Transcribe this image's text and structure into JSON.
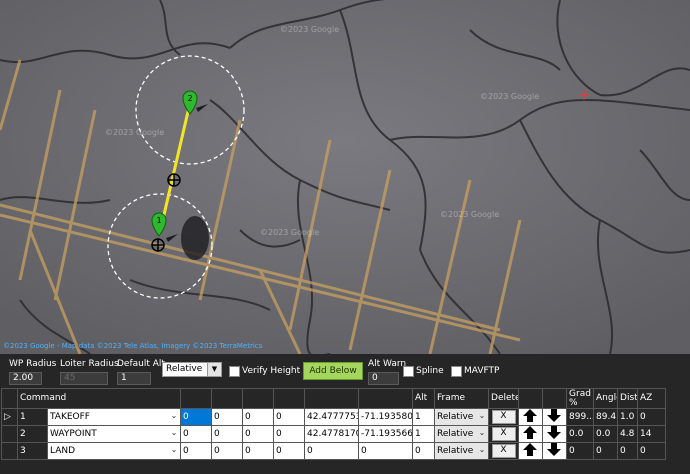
{
  "map": {
    "watermarks": [
      "©2023 Google",
      "©2023 Google",
      "©2023 Google",
      "©2023 Google",
      "©2023 Google"
    ],
    "attribution": "©2023 Google - Map data ©2023 Tele Atlas, Imagery ©2023 TerraMetrics",
    "waypoint_labels": [
      "1",
      "2"
    ],
    "colors": {
      "waypoint": "#2db82d",
      "path": "#f0e020",
      "radius_circle": "#ffffff",
      "target": "#ff3030"
    }
  },
  "controls": {
    "wp_radius_label": "WP Radius",
    "wp_radius_value": "2.00",
    "loiter_radius_label": "Loiter Radius",
    "loiter_radius_value": "45",
    "default_alt_label": "Default Alt",
    "default_alt_value": "1",
    "frame_value": "Relative",
    "verify_height_label": "Verify Height",
    "add_below_label": "Add Below",
    "alt_warn_label": "Alt Warn",
    "alt_warn_value": "0",
    "spline_label": "Spline",
    "mavftp_label": "MAVFTP"
  },
  "grid": {
    "headers": [
      "",
      "Command",
      "",
      "",
      "",
      "",
      "",
      "",
      "Alt",
      "Frame",
      "Delete",
      "",
      "",
      "Grad %",
      "Angle",
      "Dist",
      "AZ"
    ],
    "rows": [
      {
        "indicator": "▷",
        "num": "1",
        "command": "TAKEOFF",
        "p1": "0",
        "p2": "0",
        "p3": "0",
        "p4": "0",
        "lat": "42.4777753",
        "lon": "-71.1935803",
        "alt": "1",
        "frame": "Relative",
        "delete": "X",
        "grad": "899...",
        "angle": "89.4",
        "dist": "1.0",
        "az": "0"
      },
      {
        "indicator": "",
        "num": "2",
        "command": "WAYPOINT",
        "p1": "0",
        "p2": "0",
        "p3": "0",
        "p4": "0",
        "lat": "42.4778170",
        "lon": "-71.1935661",
        "alt": "1",
        "frame": "Relative",
        "delete": "X",
        "grad": "0.0",
        "angle": "0.0",
        "dist": "4.8",
        "az": "14"
      },
      {
        "indicator": "",
        "num": "3",
        "command": "LAND",
        "p1": "0",
        "p2": "0",
        "p3": "0",
        "p4": "0",
        "lat": "0",
        "lon": "0",
        "alt": "0",
        "frame": "Relative",
        "delete": "X",
        "grad": "0",
        "angle": "0",
        "dist": "0",
        "az": "0"
      }
    ]
  }
}
